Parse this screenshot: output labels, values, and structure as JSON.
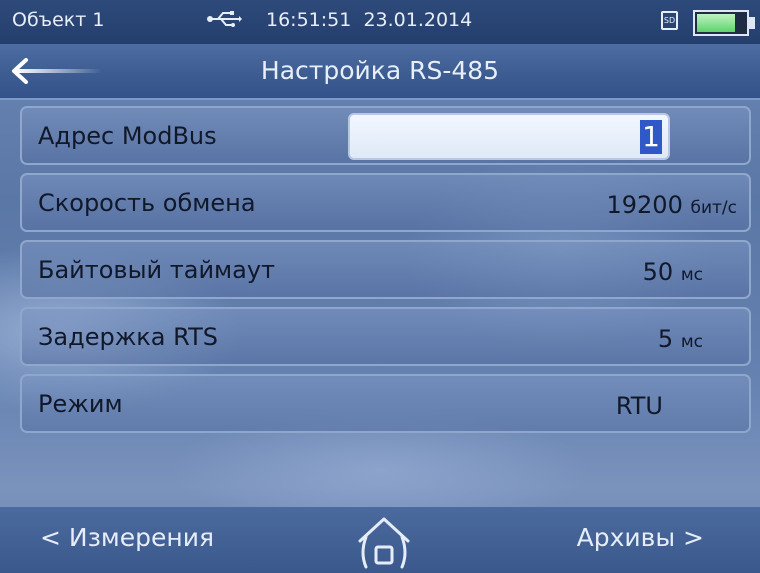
{
  "status": {
    "object": "Объект 1",
    "time": "16:51:51",
    "date": "23.01.2014",
    "usb_icon": "usb-icon",
    "sd_label": "SD",
    "battery_level": 0.8
  },
  "header": {
    "back_icon": "arrow-left-icon",
    "title": "Настройка RS-485"
  },
  "rows": [
    {
      "label": "Адрес ModBus",
      "value": "1"
    },
    {
      "label": "Скорость обмена",
      "value": "19200",
      "unit": "бит/с"
    },
    {
      "label": "Байтовый таймаут",
      "value": "50",
      "unit": "мс"
    },
    {
      "label": "Задержка RTS",
      "value": "5",
      "unit": "мс"
    },
    {
      "label": "Режим",
      "value": "RTU"
    }
  ],
  "footer": {
    "left": "< Измерения",
    "home_icon": "home-icon",
    "right": "Архивы >"
  },
  "colors": {
    "selection": "#2f59c9",
    "battery": "#5ed36b"
  }
}
